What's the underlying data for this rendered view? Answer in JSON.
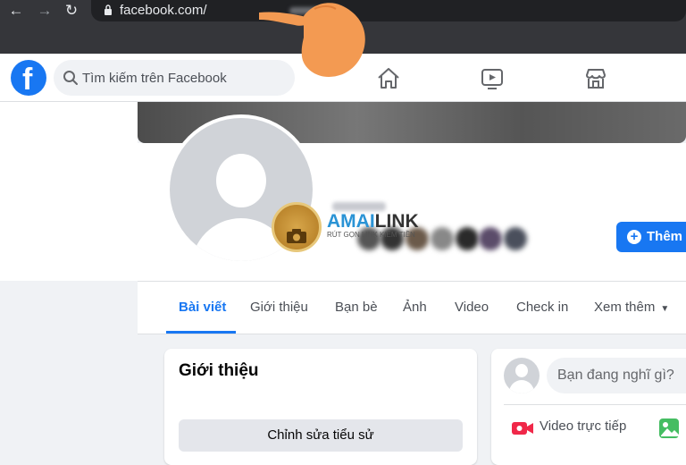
{
  "browser": {
    "back_icon": "arrow-left-icon",
    "forward_icon": "arrow-right-icon",
    "reload_icon": "reload-icon",
    "url": "facebook.com/"
  },
  "header": {
    "logo_letter": "f",
    "search_placeholder": "Tìm kiếm trên Facebook",
    "nav_icons": [
      "home-icon",
      "watch-icon",
      "marketplace-icon"
    ]
  },
  "profile": {
    "watermark_title_a": "AMAI",
    "watermark_title_b": "LINK",
    "watermark_sub": "RÚT GỌN LINK KIẾM TIỀN",
    "add_story_label": "Thêm v"
  },
  "tabs": [
    {
      "label": "Bài viết",
      "active": true
    },
    {
      "label": "Giới thiệu"
    },
    {
      "label": "Bạn bè"
    },
    {
      "label": "Ảnh"
    },
    {
      "label": "Video"
    },
    {
      "label": "Check in"
    },
    {
      "label": "Xem thêm"
    }
  ],
  "intro": {
    "title": "Giới thiệu",
    "edit_bio_label": "Chỉnh sửa tiểu sử"
  },
  "composer": {
    "placeholder": "Bạn đang nghĩ gì?",
    "live_video_label": "Video trực tiếp"
  },
  "colors": {
    "brand": "#1877f2",
    "header_bg": "#35363a"
  }
}
